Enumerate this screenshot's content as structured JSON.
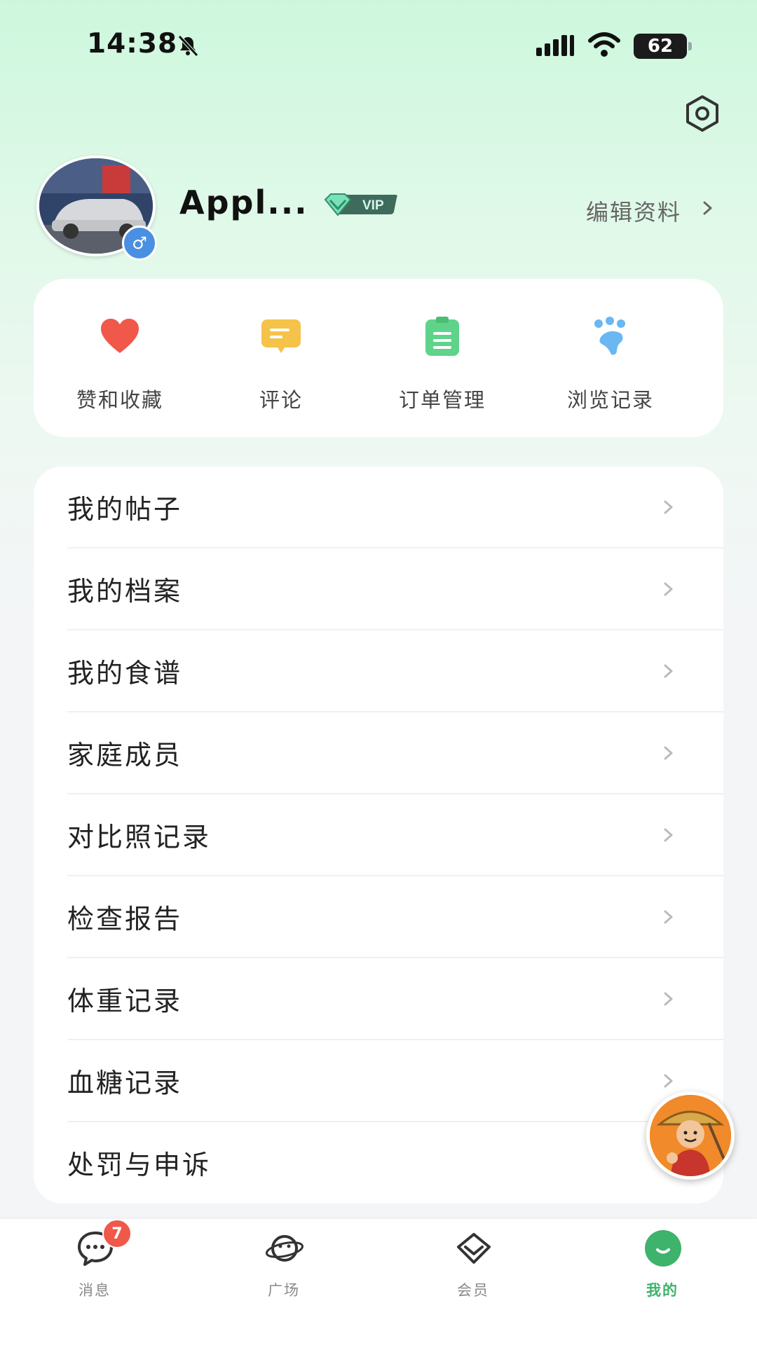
{
  "status_bar": {
    "time": "14:38",
    "battery": "62"
  },
  "profile": {
    "username": "Appl...",
    "vip_label": "VIP",
    "edit_label": "编辑资料"
  },
  "quick_actions": [
    {
      "label": "赞和收藏",
      "icon": "heart-icon",
      "color": "#f0584a"
    },
    {
      "label": "评论",
      "icon": "comment-icon",
      "color": "#f5c24a"
    },
    {
      "label": "订单管理",
      "icon": "clipboard-icon",
      "color": "#5fd38a"
    },
    {
      "label": "浏览记录",
      "icon": "paw-icon",
      "color": "#6ab7f2"
    }
  ],
  "menu": [
    {
      "label": "我的帖子"
    },
    {
      "label": "我的档案"
    },
    {
      "label": "我的食谱"
    },
    {
      "label": "家庭成员"
    },
    {
      "label": "对比照记录"
    },
    {
      "label": "检查报告"
    },
    {
      "label": "体重记录"
    },
    {
      "label": "血糖记录"
    },
    {
      "label": "处罚与申诉"
    }
  ],
  "bottom_nav": [
    {
      "label": "消息",
      "badge": "7",
      "active": false
    },
    {
      "label": "广场",
      "active": false
    },
    {
      "label": "会员",
      "active": false
    },
    {
      "label": "我的",
      "active": true
    }
  ],
  "colors": {
    "accent": "#3db36b",
    "badge": "#f0584a"
  }
}
